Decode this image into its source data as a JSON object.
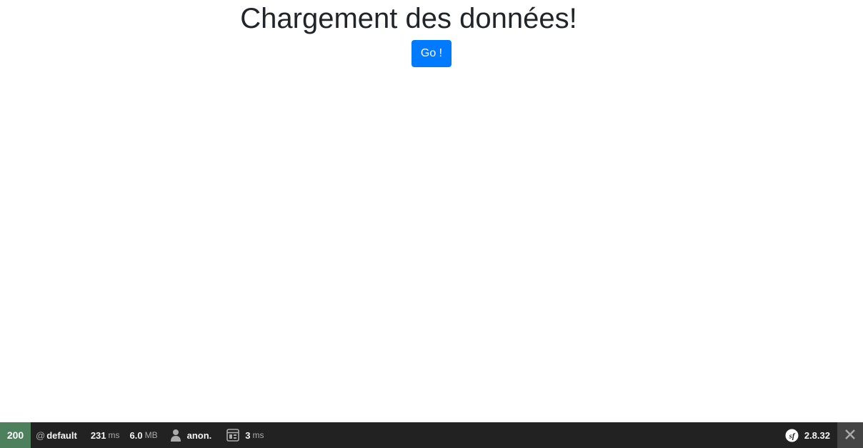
{
  "main": {
    "title": "Chargement des données!",
    "go_button": "Go !"
  },
  "toolbar": {
    "status_code": "200",
    "route_prefix": "@",
    "route": "default",
    "time_value": "231",
    "time_unit": "ms",
    "memory_value": "6.0",
    "memory_unit": "MB",
    "user": "anon.",
    "twig_value": "3",
    "twig_unit": "ms",
    "symfony_version": "2.8.32"
  },
  "colors": {
    "primary": "#007bff",
    "status_ok": "#4f805d",
    "toolbar_bg": "#222222"
  },
  "icons": [
    "user-icon",
    "twig-icon",
    "symfony-logo-icon",
    "close-icon"
  ]
}
